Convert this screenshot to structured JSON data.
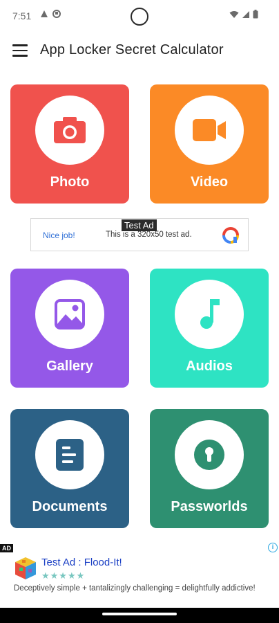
{
  "status_bar": {
    "time": "7:51"
  },
  "app_bar": {
    "title": "App Locker Secret Calculator"
  },
  "tiles": [
    {
      "label": "Photo",
      "color": "#f0524d",
      "icon": "camera-icon"
    },
    {
      "label": "Video",
      "color": "#fb8a26",
      "icon": "video-camera-icon"
    },
    {
      "label": "Gallery",
      "color": "#9458e8",
      "icon": "image-icon"
    },
    {
      "label": "Audios",
      "color": "#2ee3c3",
      "icon": "music-note-icon"
    },
    {
      "label": "Documents",
      "color": "#2c6186",
      "icon": "document-icon"
    },
    {
      "label": "Passworlds",
      "color": "#2e9071",
      "icon": "keyhole-icon"
    }
  ],
  "banner_ad": {
    "tag": "Test Ad",
    "nice": "Nice job!",
    "text": "This is a 320x50 test ad."
  },
  "bottom_ad": {
    "badge": "AD",
    "title": "Test Ad : Flood-It!",
    "stars": "★★★★★",
    "rating": 4.5,
    "description": "Deceptively simple + tantalizingly challenging = delightfully addictive!"
  }
}
